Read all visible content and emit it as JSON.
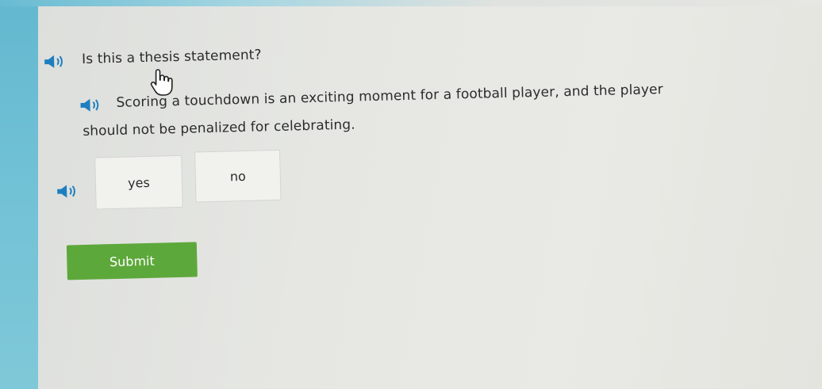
{
  "question": {
    "prompt": "Is this a thesis statement?",
    "statement_line1": "Scoring a touchdown is an exciting moment for a football player, and the player",
    "statement_line2": "should not be penalized for celebrating."
  },
  "choices": [
    {
      "label": "yes"
    },
    {
      "label": "no"
    }
  ],
  "submit": {
    "label": "Submit"
  },
  "colors": {
    "accent_blue": "#63b8cf",
    "submit_green": "#5da83b",
    "speaker_blue": "#1e7fc0"
  },
  "icons": {
    "speaker": "speaker-icon",
    "cursor": "hand-pointer-cursor-icon"
  }
}
